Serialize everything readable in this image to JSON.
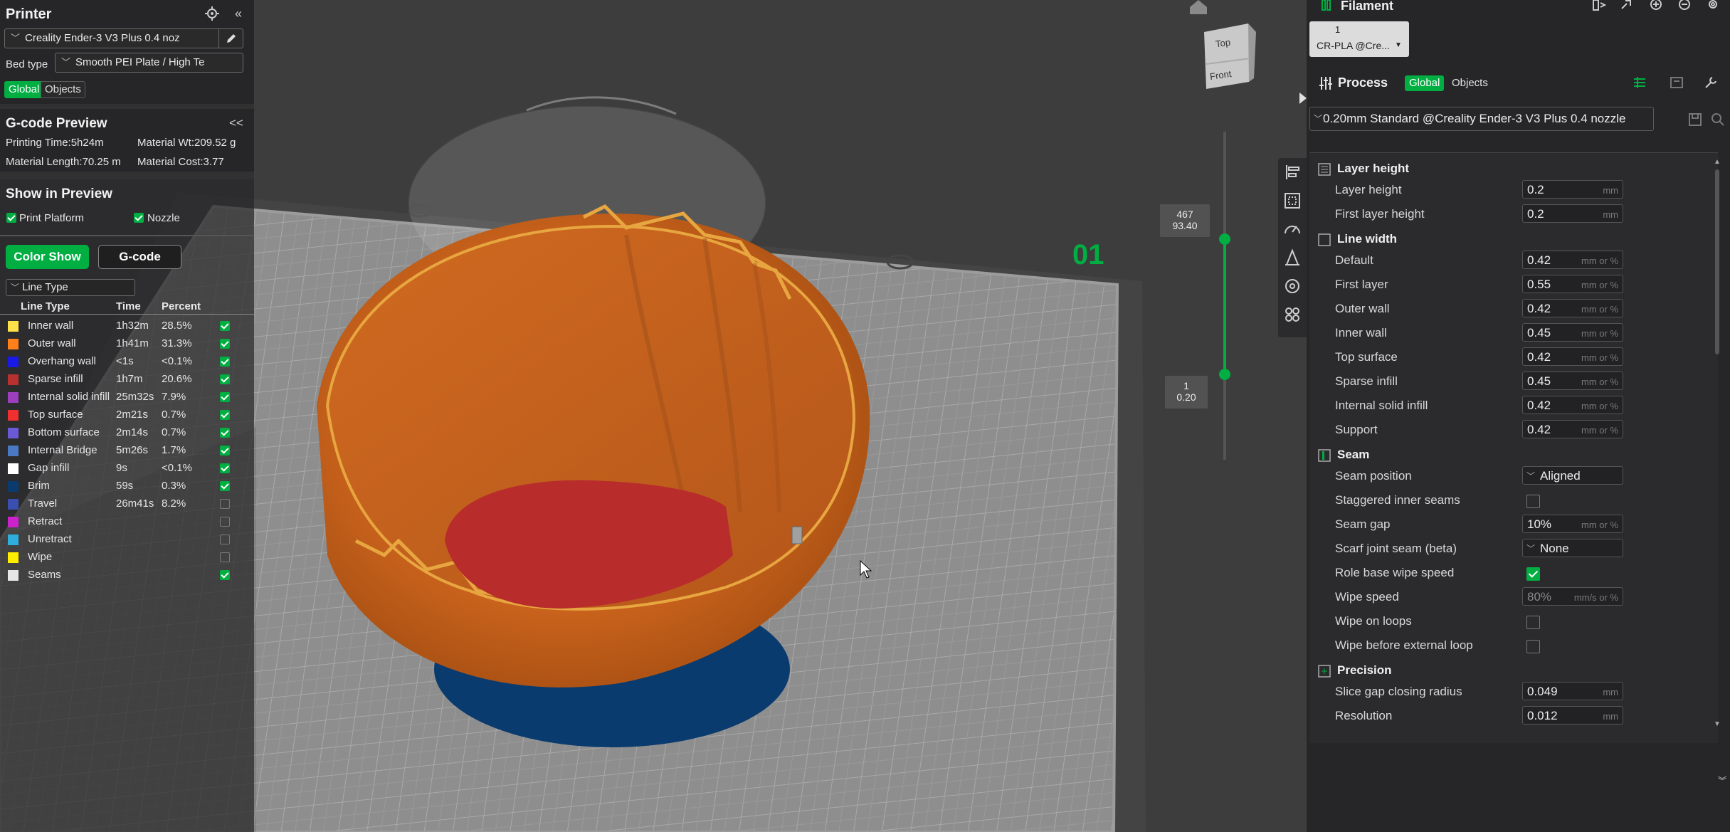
{
  "printer_panel": {
    "title": "Printer",
    "printer_preset": "Creality Ender-3 V3 Plus 0.4 noz",
    "bed_type_label": "Bed type",
    "bed_type": "Smooth PEI Plate / High Te",
    "tabs": [
      "Global",
      "Objects"
    ]
  },
  "gcode_preview": {
    "title": "G-code Preview",
    "collapse": "<<",
    "printing_time": "Printing Time:5h24m",
    "material_wt": "Material Wt:209.52 g",
    "material_length": "Material Length:70.25 m",
    "material_cost": "Material Cost:3.77"
  },
  "show_in_preview": {
    "title": "Show in Preview",
    "print_platform": "Print Platform",
    "nozzle": "Nozzle",
    "color_show": "Color Show",
    "gcode": "G-code",
    "line_type_select": "Line Type",
    "headers": [
      "Line Type",
      "Time",
      "Percent"
    ],
    "rows": [
      {
        "name": "Inner wall",
        "time": "1h32m",
        "percent": "28.5%",
        "color": "#ffe24a",
        "checked": true
      },
      {
        "name": "Outer wall",
        "time": "1h41m",
        "percent": "31.3%",
        "color": "#ff7f1a",
        "checked": true
      },
      {
        "name": "Overhang wall",
        "time": "<1s",
        "percent": "<0.1%",
        "color": "#1a1ae6",
        "checked": true
      },
      {
        "name": "Sparse infill",
        "time": "1h7m",
        "percent": "20.6%",
        "color": "#b8312f",
        "checked": true
      },
      {
        "name": "Internal solid infill",
        "time": "25m32s",
        "percent": "7.9%",
        "color": "#9b3fbf",
        "checked": true
      },
      {
        "name": "Top surface",
        "time": "2m21s",
        "percent": "0.7%",
        "color": "#f0302f",
        "checked": true
      },
      {
        "name": "Bottom surface",
        "time": "2m14s",
        "percent": "0.7%",
        "color": "#6a5ad6",
        "checked": true
      },
      {
        "name": "Internal Bridge",
        "time": "5m26s",
        "percent": "1.7%",
        "color": "#4a78c2",
        "checked": true
      },
      {
        "name": "Gap infill",
        "time": "9s",
        "percent": "<0.1%",
        "color": "#ffffff",
        "checked": true
      },
      {
        "name": "Brim",
        "time": "59s",
        "percent": "0.3%",
        "color": "#0a3b6e",
        "checked": true
      },
      {
        "name": "Travel",
        "time": "26m41s",
        "percent": "8.2%",
        "color": "#3a4fb0",
        "checked": false
      },
      {
        "name": "Retract",
        "time": "",
        "percent": "",
        "color": "#cc22cc",
        "checked": false
      },
      {
        "name": "Unretract",
        "time": "",
        "percent": "",
        "color": "#2eaedc",
        "checked": false
      },
      {
        "name": "Wipe",
        "time": "",
        "percent": "",
        "color": "#ffee00",
        "checked": false
      },
      {
        "name": "Seams",
        "time": "",
        "percent": "",
        "color": "#e6e6e6",
        "checked": true
      }
    ]
  },
  "viewport": {
    "plate_label": "01",
    "layer_top": {
      "layer": "467",
      "height": "93.40"
    },
    "layer_bottom": {
      "layer": "1",
      "height": "0.20"
    },
    "view_cube": {
      "top": "Top",
      "front": "Front"
    }
  },
  "filament": {
    "title": "Filament",
    "slot_number": "1",
    "slot_name": "CR-PLA @Cre..."
  },
  "process": {
    "title": "Process",
    "tabs": [
      "Global",
      "Objects"
    ],
    "preset": "0.20mm Standard  @Creality Ender-3 V3 Plus 0.4 nozzle",
    "sections": [
      {
        "title": "Layer height",
        "rows": [
          {
            "label": "Layer height",
            "type": "input",
            "value": "0.2",
            "unit": "mm"
          },
          {
            "label": "First layer height",
            "type": "input",
            "value": "0.2",
            "unit": "mm"
          }
        ]
      },
      {
        "title": "Line width",
        "rows": [
          {
            "label": "Default",
            "type": "input",
            "value": "0.42",
            "unit": "mm or %"
          },
          {
            "label": "First layer",
            "type": "input",
            "value": "0.55",
            "unit": "mm or %"
          },
          {
            "label": "Outer wall",
            "type": "input",
            "value": "0.42",
            "unit": "mm or %"
          },
          {
            "label": "Inner wall",
            "type": "input",
            "value": "0.45",
            "unit": "mm or %"
          },
          {
            "label": "Top surface",
            "type": "input",
            "value": "0.42",
            "unit": "mm or %"
          },
          {
            "label": "Sparse infill",
            "type": "input",
            "value": "0.45",
            "unit": "mm or %"
          },
          {
            "label": "Internal solid infill",
            "type": "input",
            "value": "0.42",
            "unit": "mm or %"
          },
          {
            "label": "Support",
            "type": "input",
            "value": "0.42",
            "unit": "mm or %"
          }
        ]
      },
      {
        "title": "Seam",
        "rows": [
          {
            "label": "Seam position",
            "type": "select",
            "value": "Aligned"
          },
          {
            "label": "Staggered inner seams",
            "type": "checkbox",
            "checked": false
          },
          {
            "label": "Seam gap",
            "type": "input",
            "value": "10%",
            "unit": "mm or %"
          },
          {
            "label": "Scarf joint seam (beta)",
            "type": "select",
            "value": "None"
          },
          {
            "label": "Role base wipe speed",
            "type": "checkbox",
            "checked": true
          },
          {
            "label": "Wipe speed",
            "type": "input",
            "value": "80%",
            "unit": "mm/s or %",
            "disabled": true
          },
          {
            "label": "Wipe on loops",
            "type": "checkbox",
            "checked": false
          },
          {
            "label": "Wipe before external loop",
            "type": "checkbox",
            "checked": false
          }
        ]
      },
      {
        "title": "Precision",
        "rows": [
          {
            "label": "Slice gap closing radius",
            "type": "input",
            "value": "0.049",
            "unit": "mm"
          },
          {
            "label": "Resolution",
            "type": "input",
            "value": "0.012",
            "unit": "mm"
          }
        ]
      }
    ]
  }
}
